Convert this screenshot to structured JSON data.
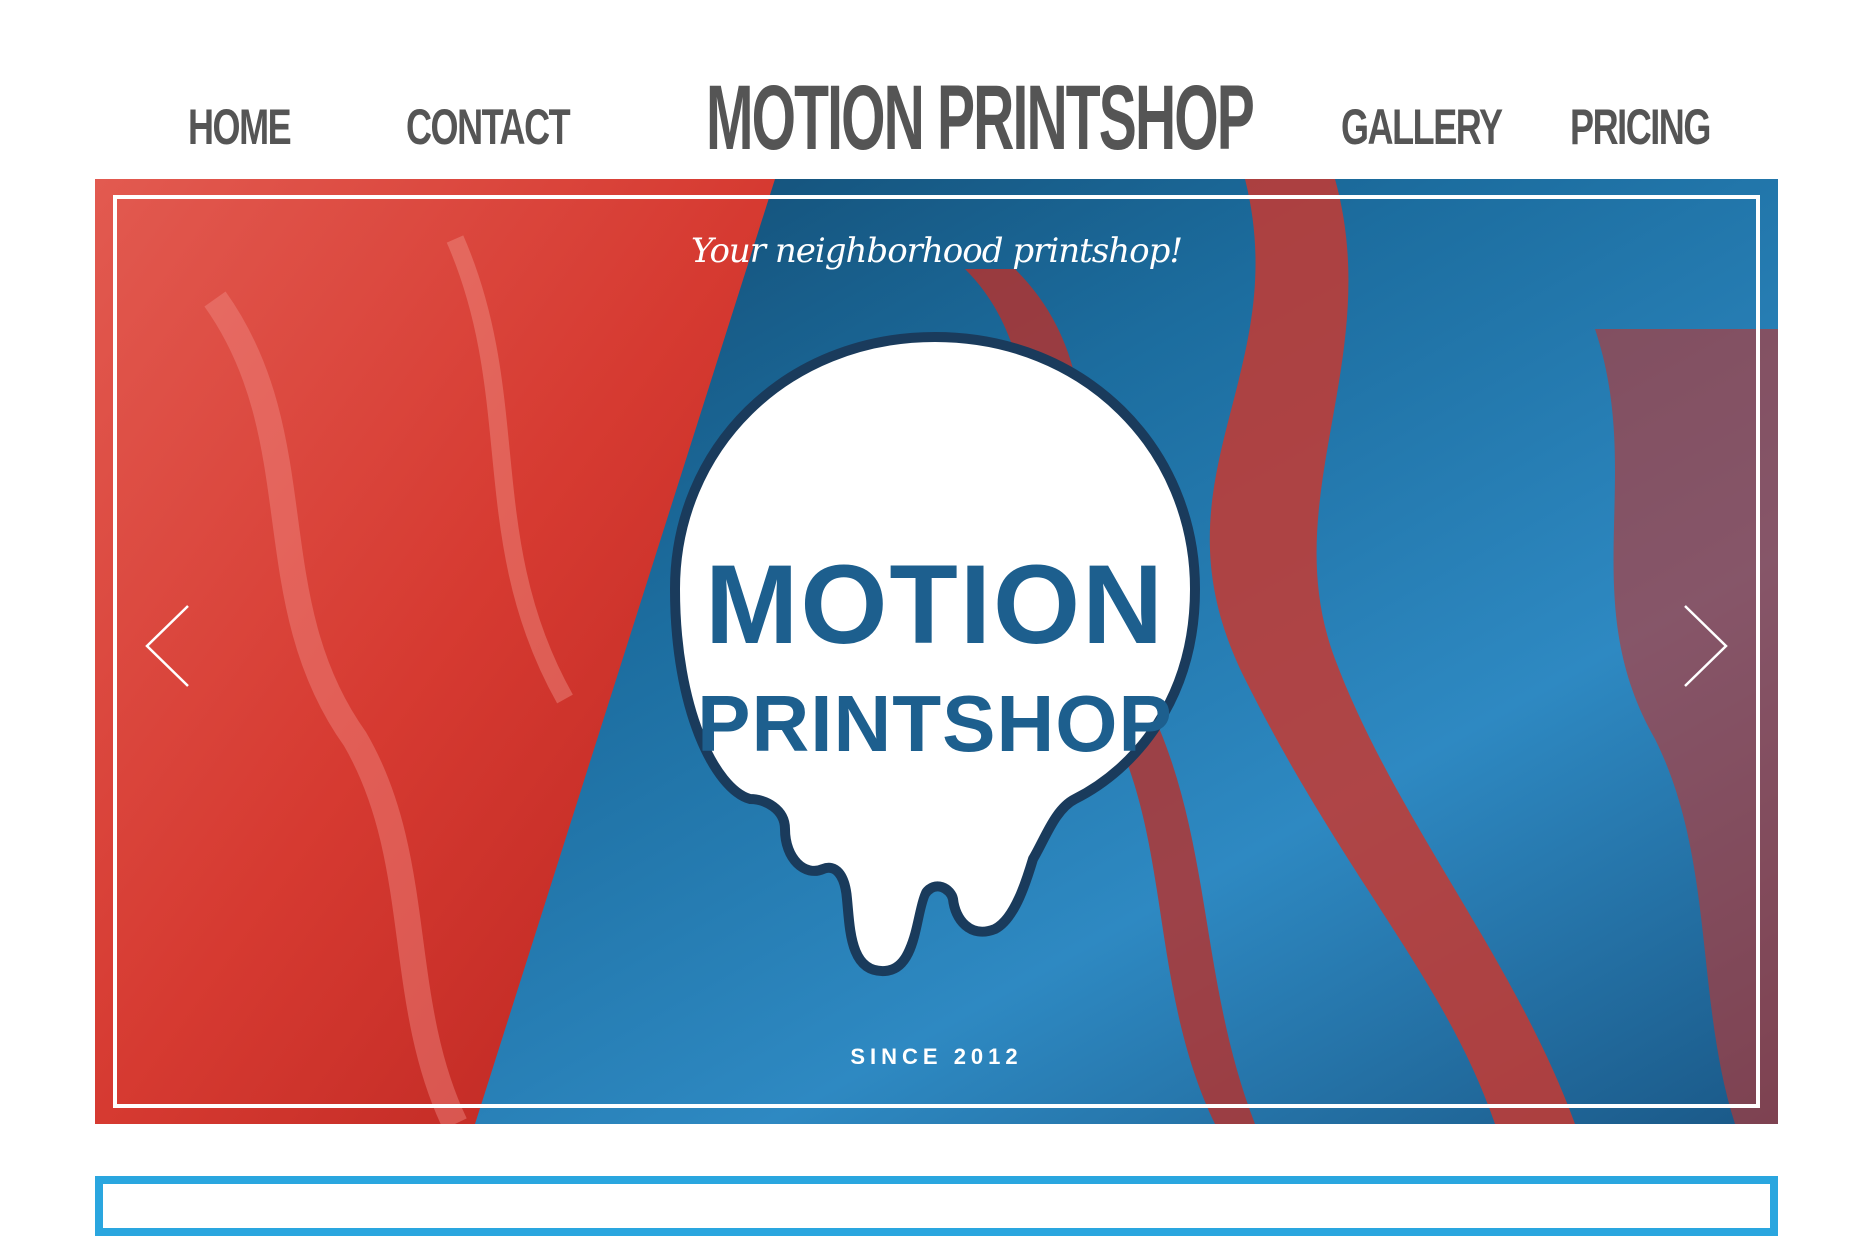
{
  "nav": {
    "left": [
      {
        "label": "HOME"
      },
      {
        "label": "CONTACT"
      }
    ],
    "brand": "MOTION PRINTSHOP",
    "right": [
      {
        "label": "GALLERY"
      },
      {
        "label": "PRICING"
      }
    ]
  },
  "hero": {
    "tagline": "Your neighborhood printshop!",
    "logo_line1": "MOTION",
    "logo_line2": "PRINTSHOP",
    "since": "SINCE 2012",
    "prev_icon": "chevron-left-icon",
    "next_icon": "chevron-right-icon"
  },
  "colors": {
    "nav_text": "#555555",
    "accent_blue": "#2aa6df",
    "logo_blue": "#1d5f8e",
    "marble_red": "#d9332b"
  }
}
